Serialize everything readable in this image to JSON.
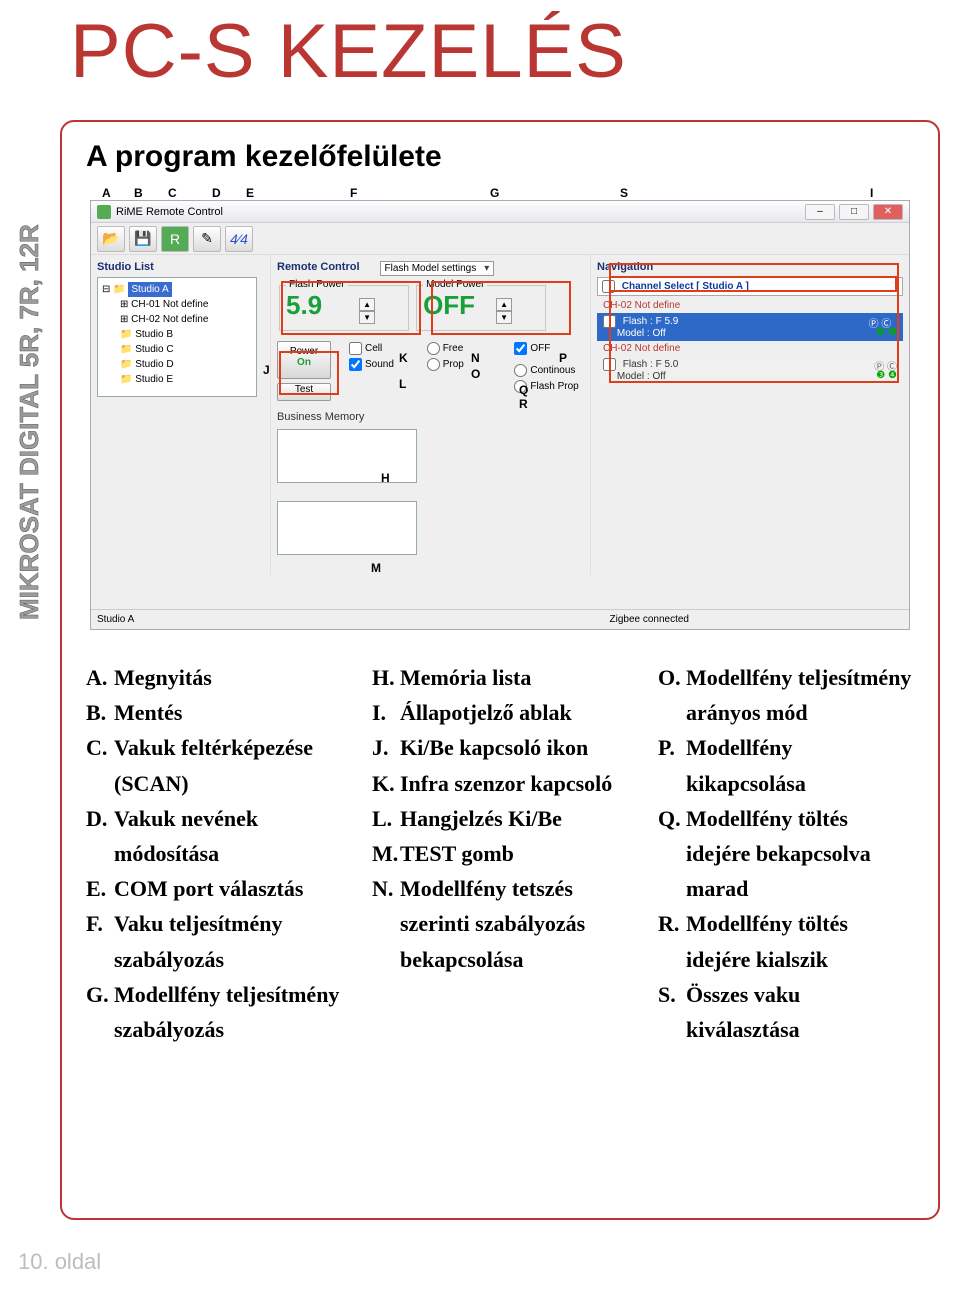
{
  "page": {
    "title": "PC-S KEZELÉS",
    "side_label": "MIKROSAT DIGITAL 5R, 7R, 12R",
    "subtitle": "A program kezelőfelülete",
    "footer": "10. oldal"
  },
  "window": {
    "title": "RiME Remote Control",
    "buttons": {
      "min": "–",
      "max": "□",
      "close": "✕"
    }
  },
  "toolbar_letters": [
    "A",
    "B",
    "C",
    "D",
    "E",
    "F",
    "G"
  ],
  "studio": {
    "section": "Studio List",
    "active": "Studio A",
    "ch01": "CH-01 Not define",
    "ch02": "CH-02 Not define",
    "items": [
      "Studio B",
      "Studio C",
      "Studio D",
      "Studio E"
    ],
    "status_name": "Studio A"
  },
  "remote": {
    "section": "Remote Control",
    "flash_label": "Flash Power",
    "flash_value": "5.9",
    "model_label": "Model Power",
    "model_value": "OFF",
    "power_label": "Power",
    "power_state": "On",
    "test": "Test",
    "cell": "Cell",
    "sound": "Sound",
    "free": "Free",
    "prop": "Prop",
    "off": "OFF",
    "cont": "Continous",
    "flashprop": "Flash Prop",
    "settings_dd": "Flash Model settings",
    "biz_label": "Business Memory"
  },
  "nav": {
    "section": "Navigation",
    "channel_select": "Channel Select [ Studio A ]",
    "row1": "CH-02  Not define",
    "row2a": "Flash : F 5.9",
    "row2b": "Model : Off",
    "row3": "CH-02  Not define",
    "row4a": "Flash : F 5.0",
    "row4b": "Model : Off"
  },
  "statusbar": {
    "connected": "Zigbee connected"
  },
  "annot_letters": {
    "S": "S",
    "I": "I",
    "J": "J",
    "K": "K",
    "L": "L",
    "M": "M",
    "N": "N",
    "O": "O",
    "P": "P",
    "Q": "Q",
    "R": "R",
    "H": "H"
  },
  "legend": {
    "col1": [
      {
        "l": "A.",
        "t": "Megnyitás"
      },
      {
        "l": "B.",
        "t": "Mentés"
      },
      {
        "l": "C.",
        "t": "Vakuk feltérképezése (SCAN)"
      },
      {
        "l": "D.",
        "t": "Vakuk nevének módosítása"
      },
      {
        "l": "E.",
        "t": "COM port választás"
      },
      {
        "l": "F.",
        "t": "Vaku teljesítmény szabályozás"
      },
      {
        "l": "G.",
        "t": "Modellfény teljesítmény szabályozás"
      }
    ],
    "col2": [
      {
        "l": "H.",
        "t": "Memória lista"
      },
      {
        "l": "I.",
        "t": "Állapotjelző ablak"
      },
      {
        "l": "J.",
        "t": "Ki/Be kapcsoló ikon"
      },
      {
        "l": "K.",
        "t": "Infra szenzor kapcsoló"
      },
      {
        "l": "L.",
        "t": "Hangjelzés Ki/Be"
      },
      {
        "l": "M.",
        "t": "TEST gomb"
      },
      {
        "l": "N.",
        "t": "Modellfény tetszés szerinti szabályozás bekapcsolása"
      }
    ],
    "col3": [
      {
        "l": "O.",
        "t": "Modellfény teljesítmény arányos mód"
      },
      {
        "l": "P.",
        "t": "Modellfény kikapcsolása"
      },
      {
        "l": "Q.",
        "t": "Modellfény töltés idejére bekapcsolva marad"
      },
      {
        "l": "R.",
        "t": "Modellfény töltés idejére kialszik"
      },
      {
        "l": "S.",
        "t": "Összes vaku kiválasztása"
      }
    ]
  }
}
